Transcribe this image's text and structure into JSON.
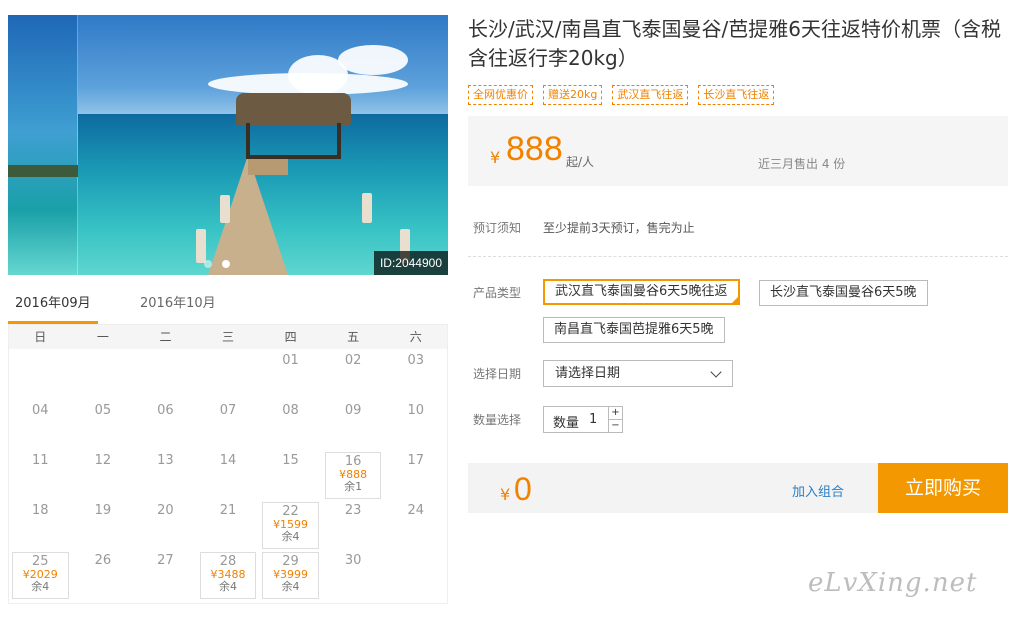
{
  "hero": {
    "id_tag": "ID:2044900"
  },
  "calendar": {
    "months": [
      "2016年09月",
      "2016年10月"
    ],
    "weekdays": [
      "日",
      "一",
      "二",
      "三",
      "四",
      "五",
      "六"
    ],
    "rows": [
      [
        {
          "d": ""
        },
        {
          "d": ""
        },
        {
          "d": ""
        },
        {
          "d": ""
        },
        {
          "d": "01"
        },
        {
          "d": "02"
        },
        {
          "d": "03"
        }
      ],
      [
        {
          "d": "04"
        },
        {
          "d": "05"
        },
        {
          "d": "06"
        },
        {
          "d": "07"
        },
        {
          "d": "08"
        },
        {
          "d": "09"
        },
        {
          "d": "10"
        }
      ],
      [
        {
          "d": "11"
        },
        {
          "d": "12"
        },
        {
          "d": "13"
        },
        {
          "d": "14"
        },
        {
          "d": "15"
        },
        {
          "d": "16",
          "p": "¥888",
          "l": "余1"
        },
        {
          "d": "17"
        }
      ],
      [
        {
          "d": "18"
        },
        {
          "d": "19"
        },
        {
          "d": "20"
        },
        {
          "d": "21"
        },
        {
          "d": "22",
          "p": "¥1599",
          "l": "余4"
        },
        {
          "d": "23"
        },
        {
          "d": "24"
        }
      ],
      [
        {
          "d": "25",
          "p": "¥2029",
          "l": "余4"
        },
        {
          "d": "26"
        },
        {
          "d": "27"
        },
        {
          "d": "28",
          "p": "¥3488",
          "l": "余4"
        },
        {
          "d": "29",
          "p": "¥3999",
          "l": "余4"
        },
        {
          "d": "30"
        },
        {
          "d": ""
        }
      ]
    ]
  },
  "product": {
    "title": "长沙/武汉/南昌直飞泰国曼谷/芭提雅6天往返特价机票（含税含往返行李20kg）",
    "tags": [
      "全网优惠价",
      "赠送20kg",
      "武汉直飞往返",
      "长沙直飞往返"
    ],
    "price_symbol": "¥",
    "price": "888",
    "price_unit": "起/人",
    "sold": "近三月售出 4 份"
  },
  "booking": {
    "notice_label": "预订须知",
    "notice_text": "至少提前3天预订，售完为止",
    "type_label": "产品类型",
    "types": [
      "武汉直飞泰国曼谷6天5晚往返",
      "长沙直飞泰国曼谷6天5晚",
      "南昌直飞泰国芭提雅6天5晚"
    ],
    "date_label": "选择日期",
    "date_placeholder": "请选择日期",
    "qty_label": "数量选择",
    "qty_inner_label": "数量",
    "qty_value": "1",
    "qty_plus": "+",
    "qty_minus": "−"
  },
  "checkout": {
    "total_symbol": "¥",
    "total": "0",
    "combo_label": "加入组合",
    "buy_label": "立即购买"
  },
  "watermark": "eLvXing.net",
  "colors": {
    "accent": "#f39800",
    "price": "#f08200",
    "link": "#2a7fc6"
  }
}
